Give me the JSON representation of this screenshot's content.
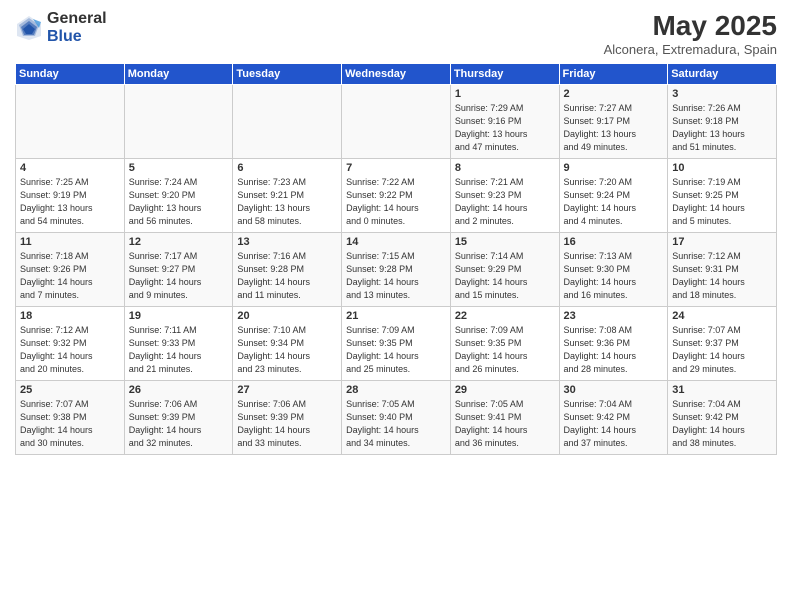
{
  "header": {
    "logo_general": "General",
    "logo_blue": "Blue",
    "title": "May 2025",
    "subtitle": "Alconera, Extremadura, Spain"
  },
  "days_of_week": [
    "Sunday",
    "Monday",
    "Tuesday",
    "Wednesday",
    "Thursday",
    "Friday",
    "Saturday"
  ],
  "weeks": [
    [
      {
        "day": "",
        "info": ""
      },
      {
        "day": "",
        "info": ""
      },
      {
        "day": "",
        "info": ""
      },
      {
        "day": "",
        "info": ""
      },
      {
        "day": "1",
        "info": "Sunrise: 7:29 AM\nSunset: 9:16 PM\nDaylight: 13 hours\nand 47 minutes."
      },
      {
        "day": "2",
        "info": "Sunrise: 7:27 AM\nSunset: 9:17 PM\nDaylight: 13 hours\nand 49 minutes."
      },
      {
        "day": "3",
        "info": "Sunrise: 7:26 AM\nSunset: 9:18 PM\nDaylight: 13 hours\nand 51 minutes."
      }
    ],
    [
      {
        "day": "4",
        "info": "Sunrise: 7:25 AM\nSunset: 9:19 PM\nDaylight: 13 hours\nand 54 minutes."
      },
      {
        "day": "5",
        "info": "Sunrise: 7:24 AM\nSunset: 9:20 PM\nDaylight: 13 hours\nand 56 minutes."
      },
      {
        "day": "6",
        "info": "Sunrise: 7:23 AM\nSunset: 9:21 PM\nDaylight: 13 hours\nand 58 minutes."
      },
      {
        "day": "7",
        "info": "Sunrise: 7:22 AM\nSunset: 9:22 PM\nDaylight: 14 hours\nand 0 minutes."
      },
      {
        "day": "8",
        "info": "Sunrise: 7:21 AM\nSunset: 9:23 PM\nDaylight: 14 hours\nand 2 minutes."
      },
      {
        "day": "9",
        "info": "Sunrise: 7:20 AM\nSunset: 9:24 PM\nDaylight: 14 hours\nand 4 minutes."
      },
      {
        "day": "10",
        "info": "Sunrise: 7:19 AM\nSunset: 9:25 PM\nDaylight: 14 hours\nand 5 minutes."
      }
    ],
    [
      {
        "day": "11",
        "info": "Sunrise: 7:18 AM\nSunset: 9:26 PM\nDaylight: 14 hours\nand 7 minutes."
      },
      {
        "day": "12",
        "info": "Sunrise: 7:17 AM\nSunset: 9:27 PM\nDaylight: 14 hours\nand 9 minutes."
      },
      {
        "day": "13",
        "info": "Sunrise: 7:16 AM\nSunset: 9:28 PM\nDaylight: 14 hours\nand 11 minutes."
      },
      {
        "day": "14",
        "info": "Sunrise: 7:15 AM\nSunset: 9:28 PM\nDaylight: 14 hours\nand 13 minutes."
      },
      {
        "day": "15",
        "info": "Sunrise: 7:14 AM\nSunset: 9:29 PM\nDaylight: 14 hours\nand 15 minutes."
      },
      {
        "day": "16",
        "info": "Sunrise: 7:13 AM\nSunset: 9:30 PM\nDaylight: 14 hours\nand 16 minutes."
      },
      {
        "day": "17",
        "info": "Sunrise: 7:12 AM\nSunset: 9:31 PM\nDaylight: 14 hours\nand 18 minutes."
      }
    ],
    [
      {
        "day": "18",
        "info": "Sunrise: 7:12 AM\nSunset: 9:32 PM\nDaylight: 14 hours\nand 20 minutes."
      },
      {
        "day": "19",
        "info": "Sunrise: 7:11 AM\nSunset: 9:33 PM\nDaylight: 14 hours\nand 21 minutes."
      },
      {
        "day": "20",
        "info": "Sunrise: 7:10 AM\nSunset: 9:34 PM\nDaylight: 14 hours\nand 23 minutes."
      },
      {
        "day": "21",
        "info": "Sunrise: 7:09 AM\nSunset: 9:35 PM\nDaylight: 14 hours\nand 25 minutes."
      },
      {
        "day": "22",
        "info": "Sunrise: 7:09 AM\nSunset: 9:35 PM\nDaylight: 14 hours\nand 26 minutes."
      },
      {
        "day": "23",
        "info": "Sunrise: 7:08 AM\nSunset: 9:36 PM\nDaylight: 14 hours\nand 28 minutes."
      },
      {
        "day": "24",
        "info": "Sunrise: 7:07 AM\nSunset: 9:37 PM\nDaylight: 14 hours\nand 29 minutes."
      }
    ],
    [
      {
        "day": "25",
        "info": "Sunrise: 7:07 AM\nSunset: 9:38 PM\nDaylight: 14 hours\nand 30 minutes."
      },
      {
        "day": "26",
        "info": "Sunrise: 7:06 AM\nSunset: 9:39 PM\nDaylight: 14 hours\nand 32 minutes."
      },
      {
        "day": "27",
        "info": "Sunrise: 7:06 AM\nSunset: 9:39 PM\nDaylight: 14 hours\nand 33 minutes."
      },
      {
        "day": "28",
        "info": "Sunrise: 7:05 AM\nSunset: 9:40 PM\nDaylight: 14 hours\nand 34 minutes."
      },
      {
        "day": "29",
        "info": "Sunrise: 7:05 AM\nSunset: 9:41 PM\nDaylight: 14 hours\nand 36 minutes."
      },
      {
        "day": "30",
        "info": "Sunrise: 7:04 AM\nSunset: 9:42 PM\nDaylight: 14 hours\nand 37 minutes."
      },
      {
        "day": "31",
        "info": "Sunrise: 7:04 AM\nSunset: 9:42 PM\nDaylight: 14 hours\nand 38 minutes."
      }
    ]
  ]
}
